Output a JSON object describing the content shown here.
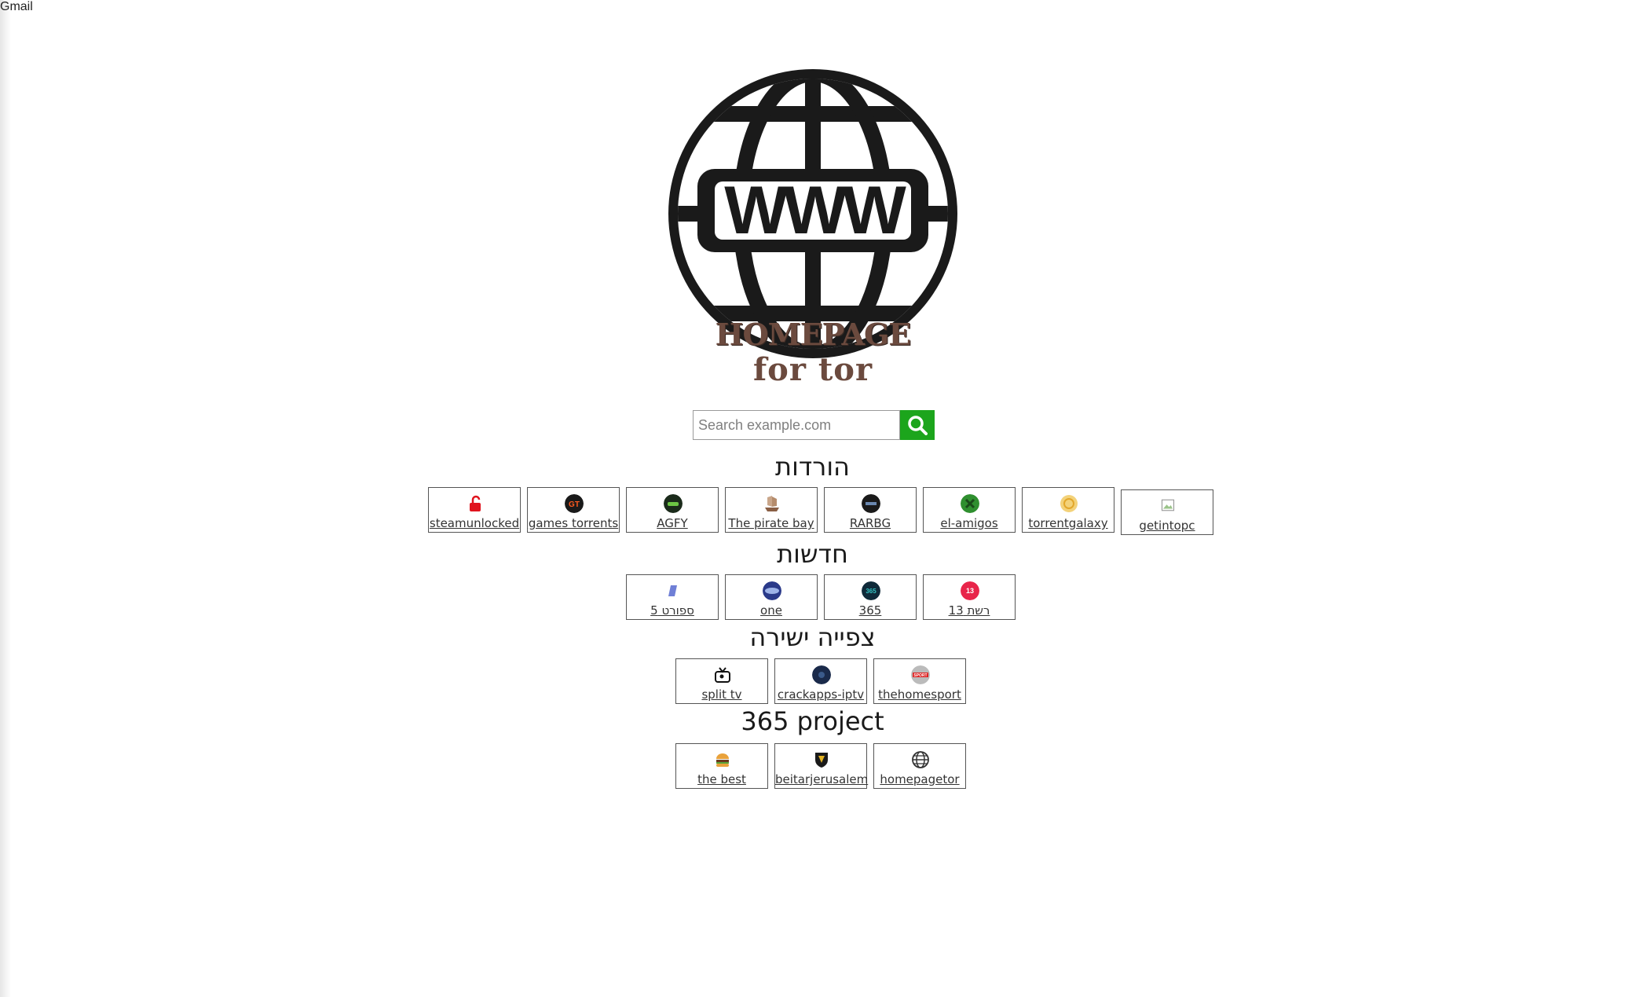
{
  "topbar": {
    "gmail_label": "Gmail"
  },
  "logo": {
    "line1": "HOMEPAGE",
    "line2": "for tor",
    "globe_text": "WWW"
  },
  "search": {
    "placeholder": "Search example.com",
    "button_icon": "search-icon",
    "button_color": "#1ca51c"
  },
  "sections": [
    {
      "title": "הורדות",
      "items": [
        {
          "label": "steamunlocked",
          "icon": "unlock-icon"
        },
        {
          "label": "games torrents",
          "icon": "gt-logo-icon"
        },
        {
          "label": "AGFY",
          "icon": "agfy-logo-icon"
        },
        {
          "label": "The pirate bay",
          "icon": "pirate-ship-icon"
        },
        {
          "label": "RARBG",
          "icon": "rarbg-logo-icon"
        },
        {
          "label": "el-amigos",
          "icon": "el-amigos-logo-icon"
        },
        {
          "label": "torrentgalaxy",
          "icon": "torrentgalaxy-logo-icon"
        },
        {
          "label": "getintopc",
          "icon": "broken-image-icon"
        }
      ]
    },
    {
      "title": "חדשות",
      "items": [
        {
          "label": "ספורט 5",
          "icon": "sport5-logo-icon"
        },
        {
          "label": "one",
          "icon": "one-logo-icon"
        },
        {
          "label": "365",
          "icon": "365-logo-icon"
        },
        {
          "label": "רשת 13",
          "icon": "reshet13-logo-icon"
        }
      ]
    },
    {
      "title": "צפייה ישירה",
      "items": [
        {
          "label": "split tv",
          "icon": "tv-icon"
        },
        {
          "label": "crackapps-iptv",
          "icon": "crackapps-logo-icon"
        },
        {
          "label": "thehomesport",
          "icon": "sport-logo-icon"
        }
      ]
    },
    {
      "title": "365 project",
      "items": [
        {
          "label": "the best",
          "icon": "burger-icon"
        },
        {
          "label": "beitarjerusalem",
          "icon": "beitar-shield-icon"
        },
        {
          "label": "homepagetor",
          "icon": "globe-icon"
        }
      ]
    }
  ]
}
